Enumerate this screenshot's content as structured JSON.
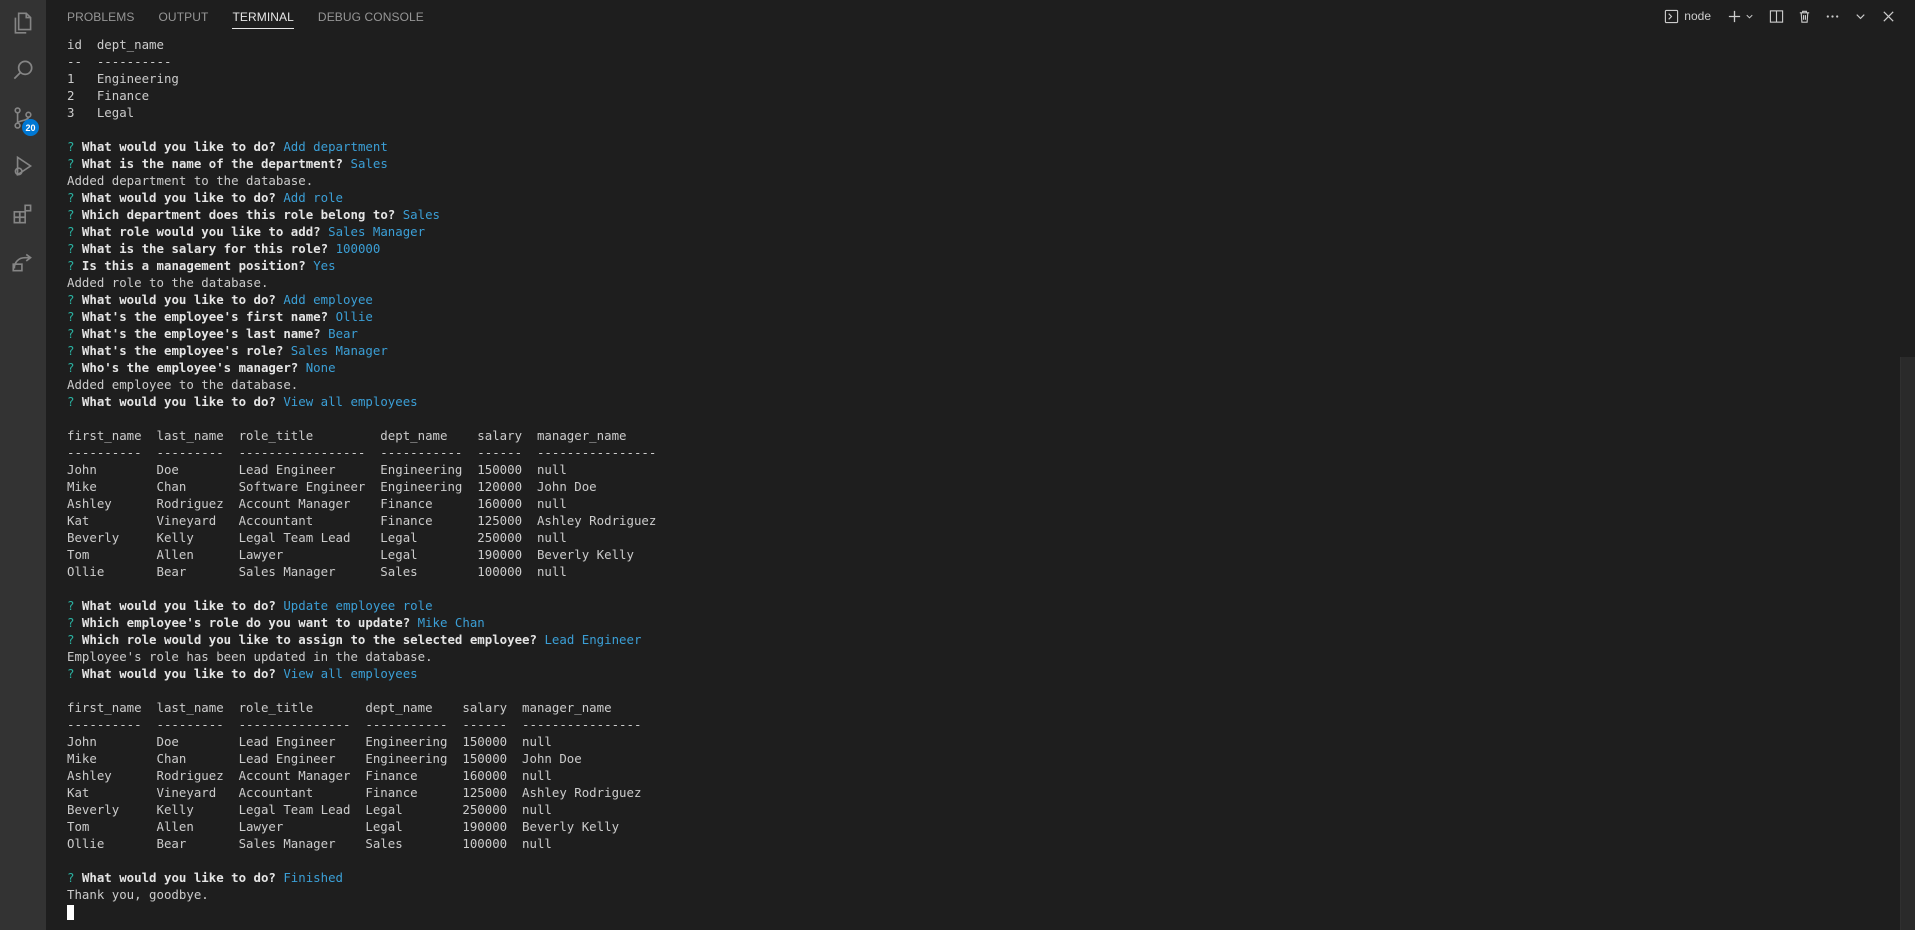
{
  "panel": {
    "tabs": [
      {
        "label": "PROBLEMS",
        "active": false
      },
      {
        "label": "OUTPUT",
        "active": false
      },
      {
        "label": "TERMINAL",
        "active": true
      },
      {
        "label": "DEBUG CONSOLE",
        "active": false
      }
    ],
    "terminal_name": "node"
  },
  "activity_bar": {
    "items": [
      "explorer-icon",
      "search-icon",
      "source-control-icon",
      "run-debug-icon",
      "extensions-icon",
      "remote-icon"
    ],
    "source_control_badge": "20"
  },
  "colors": {
    "background": "#1e1e1e",
    "activity_bar": "#333333",
    "answer": "#3b9fd6",
    "question_mark": "#2ab0a0"
  },
  "terminal": {
    "lines": [
      {
        "text": "id  dept_name"
      },
      {
        "text": "--  ----------"
      },
      {
        "text": "1   Engineering"
      },
      {
        "text": "2   Finance"
      },
      {
        "text": "3   Legal"
      },
      {
        "text": ""
      },
      {
        "q": "What would you like to do?",
        "a": "Add department"
      },
      {
        "q": "What is the name of the department?",
        "a": "Sales"
      },
      {
        "text": "Added department to the database."
      },
      {
        "q": "What would you like to do?",
        "a": "Add role"
      },
      {
        "q": "Which department does this role belong to?",
        "a": "Sales"
      },
      {
        "q": "What role would you like to add?",
        "a": "Sales Manager"
      },
      {
        "q": "What is the salary for this role?",
        "a": "100000"
      },
      {
        "q": "Is this a management position?",
        "a": "Yes"
      },
      {
        "text": "Added role to the database."
      },
      {
        "q": "What would you like to do?",
        "a": "Add employee"
      },
      {
        "q": "What's the employee's first name?",
        "a": "Ollie"
      },
      {
        "q": "What's the employee's last name?",
        "a": "Bear"
      },
      {
        "q": "What's the employee's role?",
        "a": "Sales Manager"
      },
      {
        "q": "Who's the employee's manager?",
        "a": "None"
      },
      {
        "text": "Added employee to the database."
      },
      {
        "q": "What would you like to do?",
        "a": "View all employees"
      },
      {
        "text": ""
      },
      {
        "text": "first_name  last_name  role_title         dept_name    salary  manager_name"
      },
      {
        "text": "----------  ---------  -----------------  -----------  ------  ----------------"
      },
      {
        "text": "John        Doe        Lead Engineer      Engineering  150000  null"
      },
      {
        "text": "Mike        Chan       Software Engineer  Engineering  120000  John Doe"
      },
      {
        "text": "Ashley      Rodriguez  Account Manager    Finance      160000  null"
      },
      {
        "text": "Kat         Vineyard   Accountant         Finance      125000  Ashley Rodriguez"
      },
      {
        "text": "Beverly     Kelly      Legal Team Lead    Legal        250000  null"
      },
      {
        "text": "Tom         Allen      Lawyer             Legal        190000  Beverly Kelly"
      },
      {
        "text": "Ollie       Bear       Sales Manager      Sales        100000  null"
      },
      {
        "text": ""
      },
      {
        "q": "What would you like to do?",
        "a": "Update employee role"
      },
      {
        "q": "Which employee's role do you want to update?",
        "a": "Mike Chan"
      },
      {
        "q": "Which role would you like to assign to the selected employee?",
        "a": "Lead Engineer"
      },
      {
        "text": "Employee's role has been updated in the database."
      },
      {
        "q": "What would you like to do?",
        "a": "View all employees"
      },
      {
        "text": ""
      },
      {
        "text": "first_name  last_name  role_title       dept_name    salary  manager_name"
      },
      {
        "text": "----------  ---------  ---------------  -----------  ------  ----------------"
      },
      {
        "text": "John        Doe        Lead Engineer    Engineering  150000  null"
      },
      {
        "text": "Mike        Chan       Lead Engineer    Engineering  150000  John Doe"
      },
      {
        "text": "Ashley      Rodriguez  Account Manager  Finance      160000  null"
      },
      {
        "text": "Kat         Vineyard   Accountant       Finance      125000  Ashley Rodriguez"
      },
      {
        "text": "Beverly     Kelly      Legal Team Lead  Legal        250000  null"
      },
      {
        "text": "Tom         Allen      Lawyer           Legal        190000  Beverly Kelly"
      },
      {
        "text": "Ollie       Bear       Sales Manager    Sales        100000  null"
      },
      {
        "text": ""
      },
      {
        "q": "What would you like to do?",
        "a": "Finished"
      },
      {
        "text": "Thank you, goodbye."
      }
    ]
  }
}
